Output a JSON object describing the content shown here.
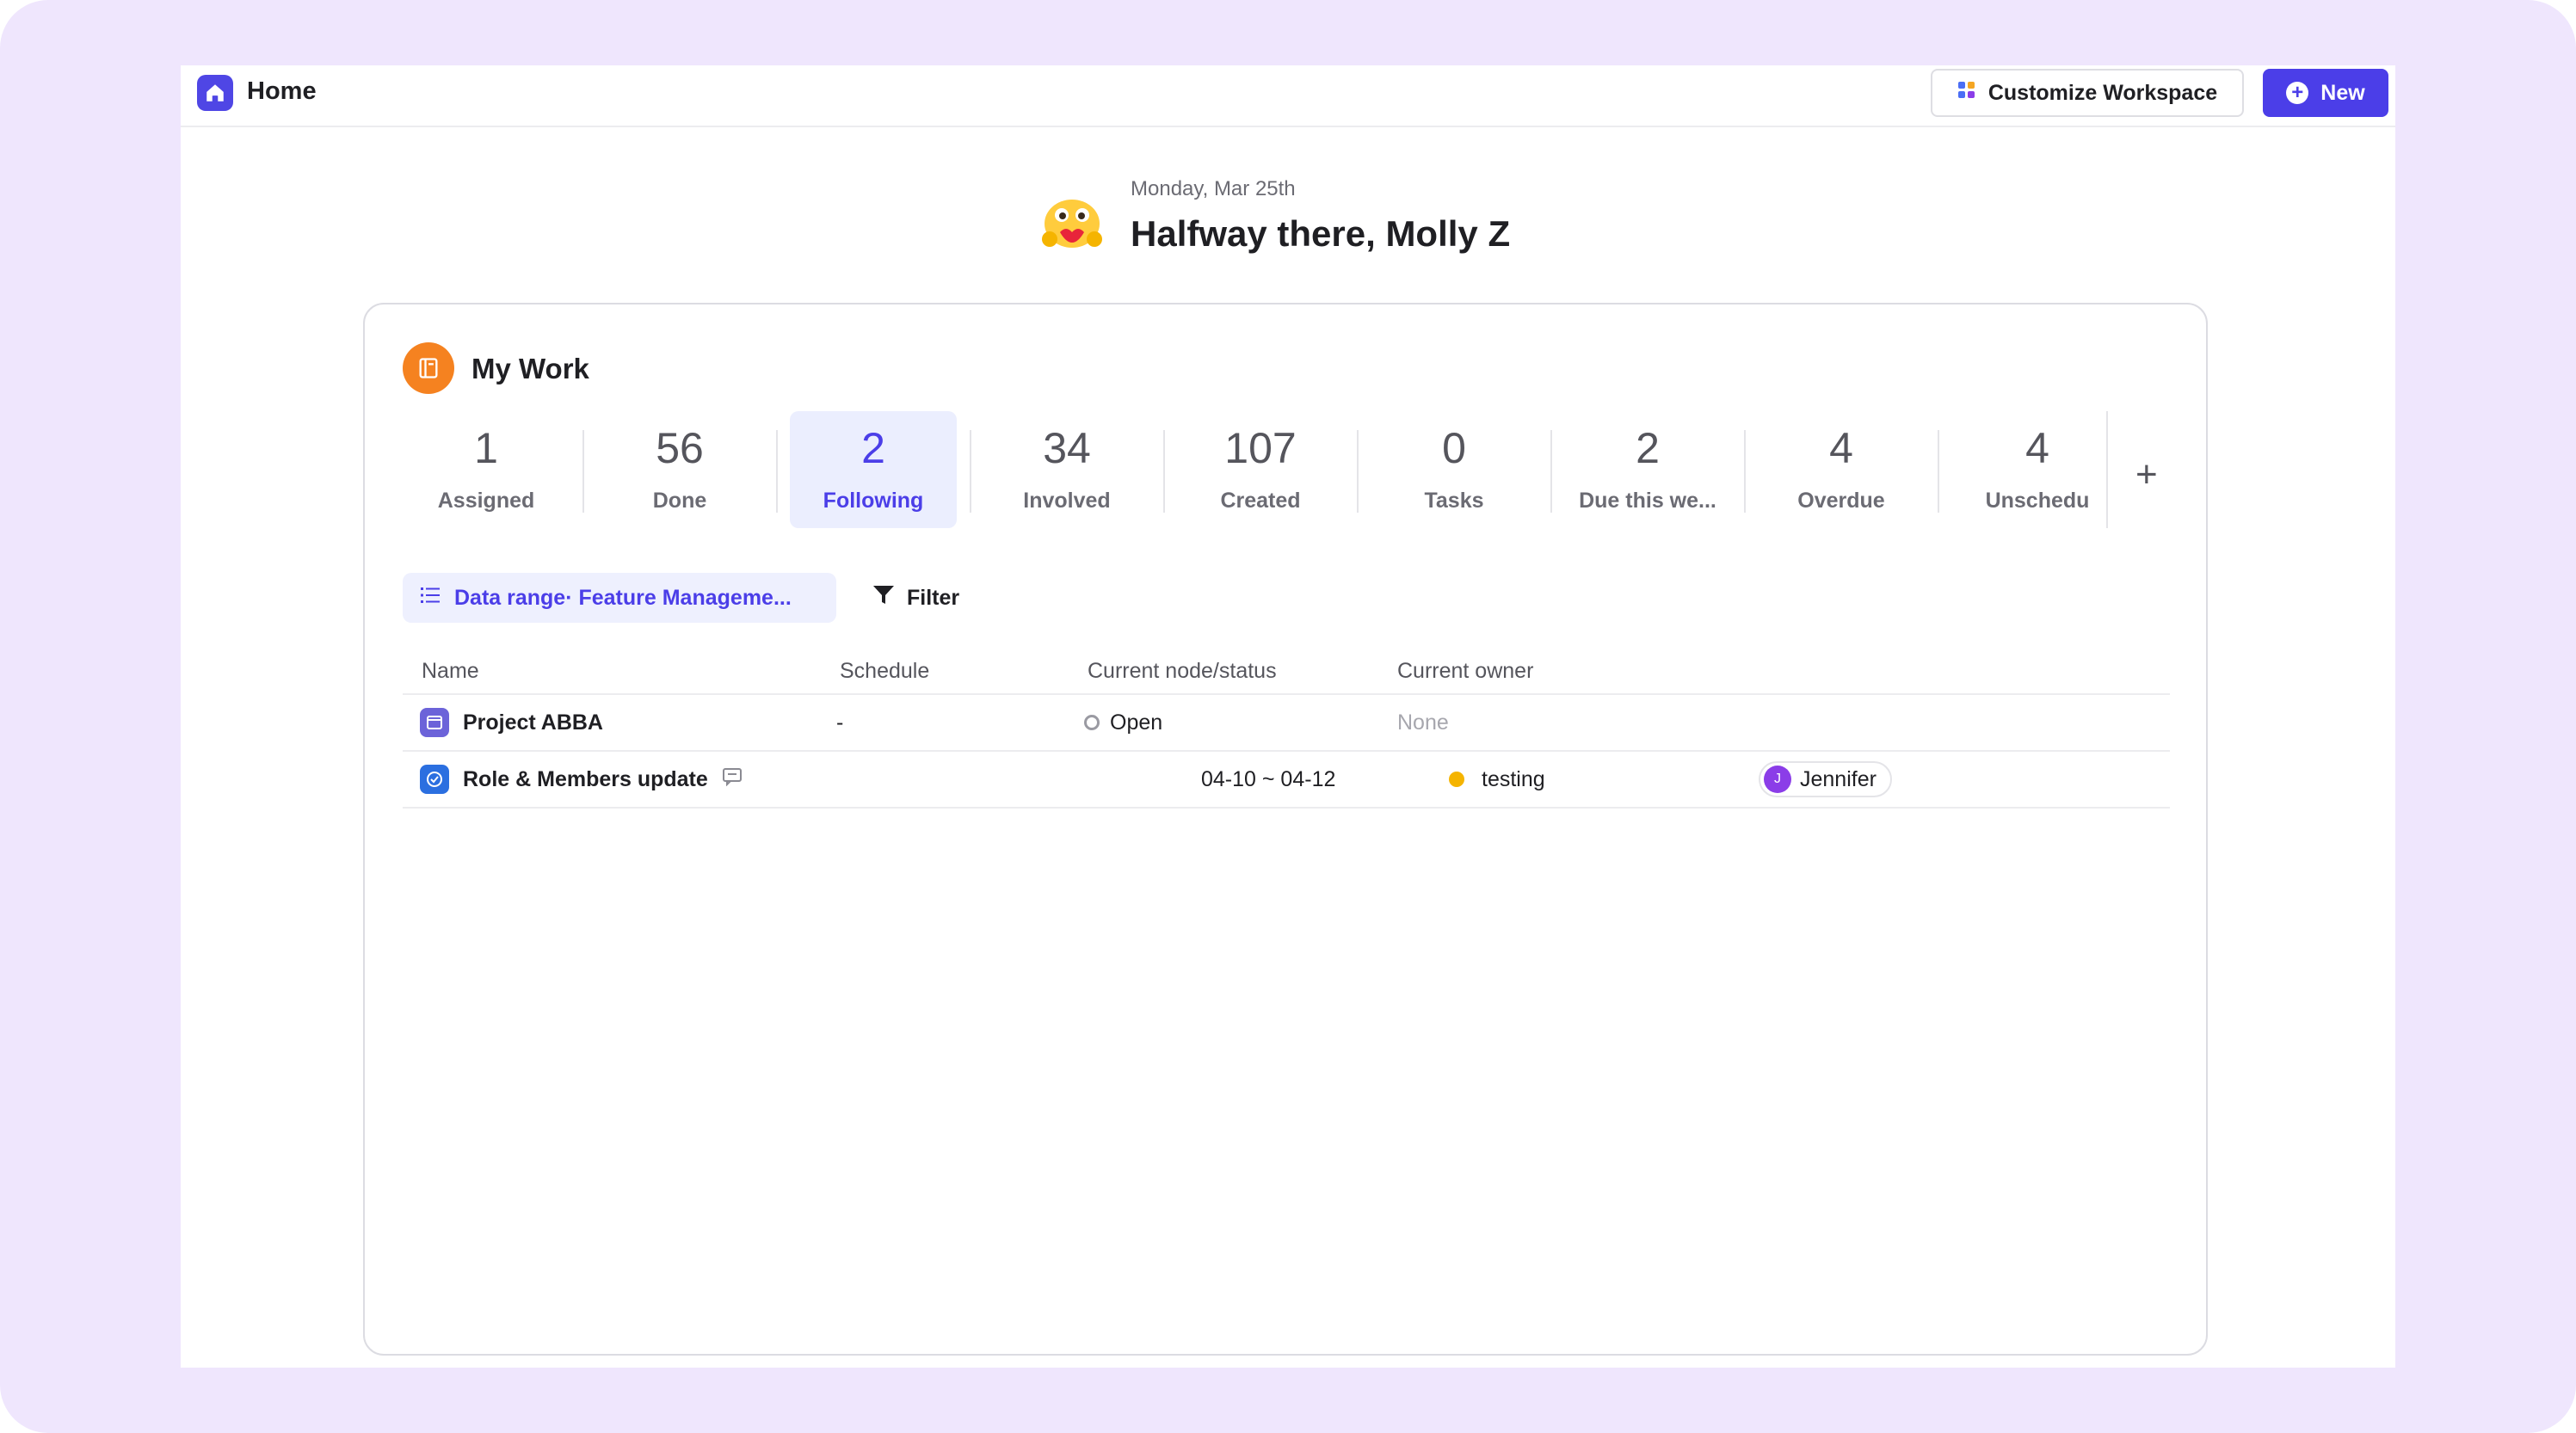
{
  "header": {
    "title": "Home",
    "customize_label": "Customize Workspace",
    "new_label": "New"
  },
  "greeting": {
    "date": "Monday, Mar 25th",
    "title": "Halfway there, Molly Z"
  },
  "mywork": {
    "title": "My Work",
    "stats": [
      {
        "value": "1",
        "label": "Assigned"
      },
      {
        "value": "56",
        "label": "Done"
      },
      {
        "value": "2",
        "label": "Following"
      },
      {
        "value": "34",
        "label": "Involved"
      },
      {
        "value": "107",
        "label": "Created"
      },
      {
        "value": "0",
        "label": "Tasks"
      },
      {
        "value": "2",
        "label": "Due this we..."
      },
      {
        "value": "4",
        "label": "Overdue"
      },
      {
        "value": "4",
        "label": "Unschedu"
      }
    ],
    "active_stat": "Following",
    "add_label": "+",
    "range_label": "Data range· Feature Manageme...",
    "filter_label": "Filter",
    "columns": [
      "Name",
      "Schedule",
      "Current node/status",
      "Current owner"
    ],
    "rows": [
      {
        "name": "Project ABBA",
        "schedule": "-",
        "status": "Open",
        "owner": "None",
        "owner_initial": ""
      },
      {
        "name": "Role & Members update",
        "schedule": "04-10 ~ 04-12",
        "status": "testing",
        "owner": "Jennifer",
        "owner_initial": "J"
      }
    ]
  },
  "colors": {
    "accent": "#4b3ee8",
    "frame": "#efe6fd",
    "mywork_icon": "#f58220",
    "status_testing": "#f5b400"
  }
}
